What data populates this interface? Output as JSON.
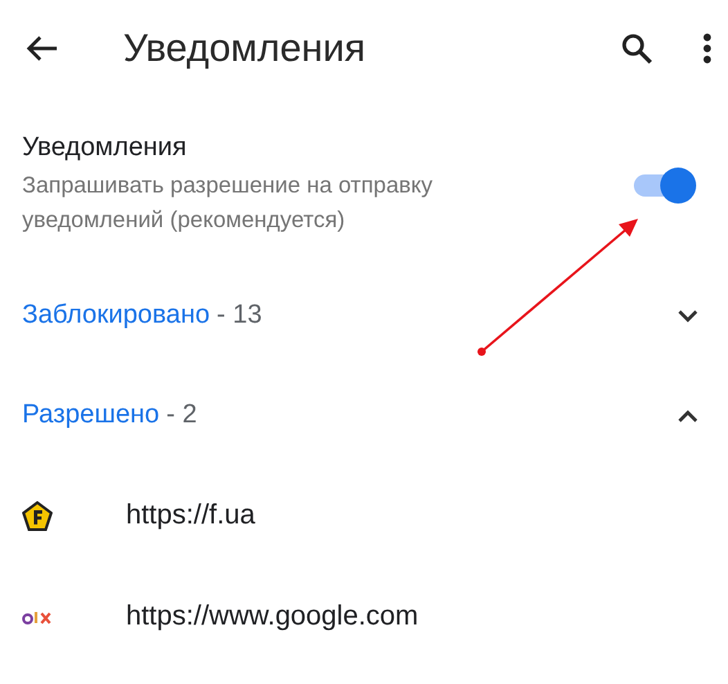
{
  "header": {
    "title": "Уведомления"
  },
  "setting": {
    "title": "Уведомления",
    "description": "Запрашивать разрешение на отправку уведомлений (рекомендуется)",
    "on": true
  },
  "sections": [
    {
      "label": "Заблокировано",
      "count": "- 13",
      "expanded": false
    },
    {
      "label": "Разрешено",
      "count": "- 2",
      "expanded": true,
      "sites": [
        {
          "url": "https://f.ua",
          "kind": "pentagon"
        },
        {
          "url": "https://www.google.com",
          "kind": "dots"
        }
      ]
    }
  ]
}
